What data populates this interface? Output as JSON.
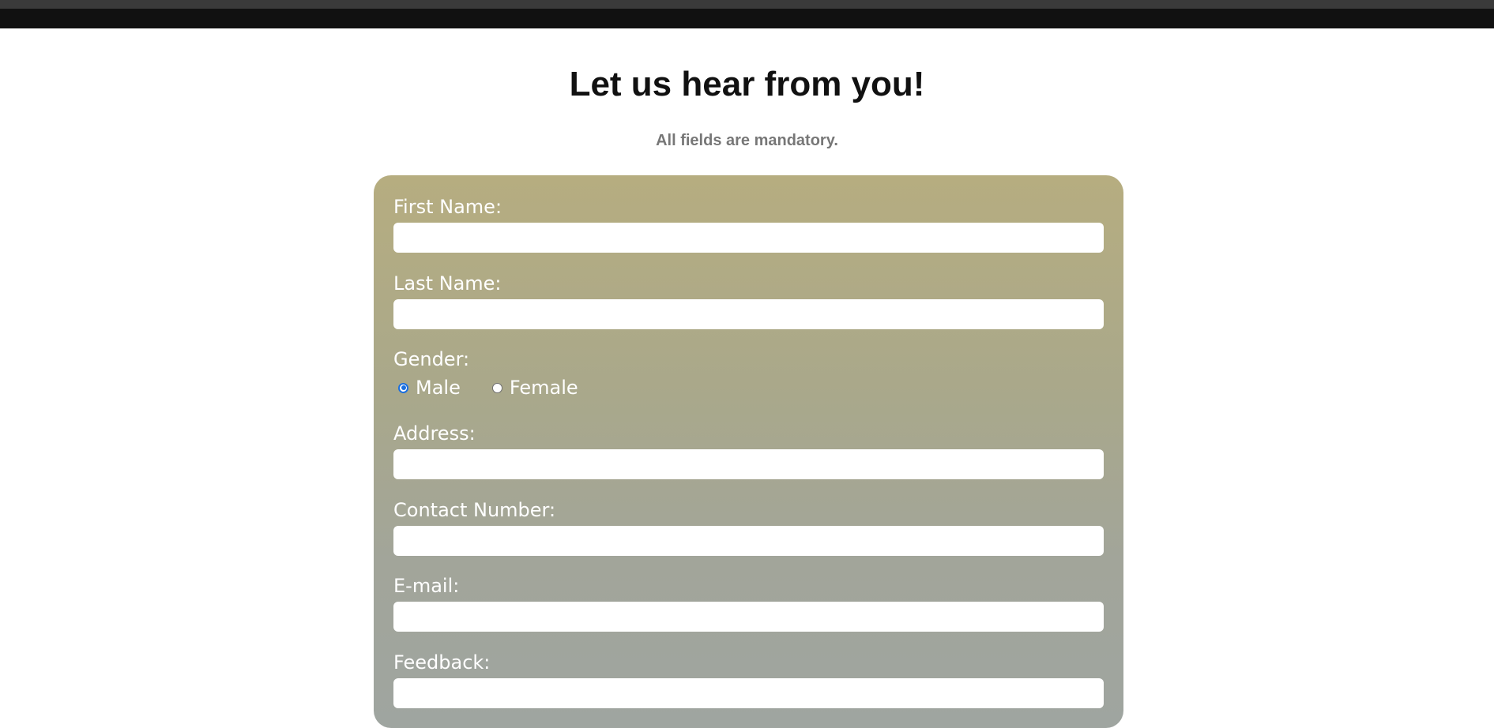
{
  "header": {
    "title": "Let us hear from you!",
    "subtitle": "All fields are mandatory."
  },
  "form": {
    "first_name_label": "First Name:",
    "first_name_value": "",
    "last_name_label": "Last Name:",
    "last_name_value": "",
    "gender_label": "Gender:",
    "gender_options": [
      "Male",
      "Female"
    ],
    "gender_selected": "Male",
    "address_label": "Address:",
    "address_value": "",
    "contact_label": "Contact Number:",
    "contact_value": "",
    "email_label": "E-mail:",
    "email_value": "",
    "feedback_label": "Feedback:",
    "feedback_value": ""
  },
  "colors": {
    "panel_top": "#b6ad80",
    "panel_bottom": "#9fa5a0",
    "radio_accent": "#1a6fe0"
  }
}
